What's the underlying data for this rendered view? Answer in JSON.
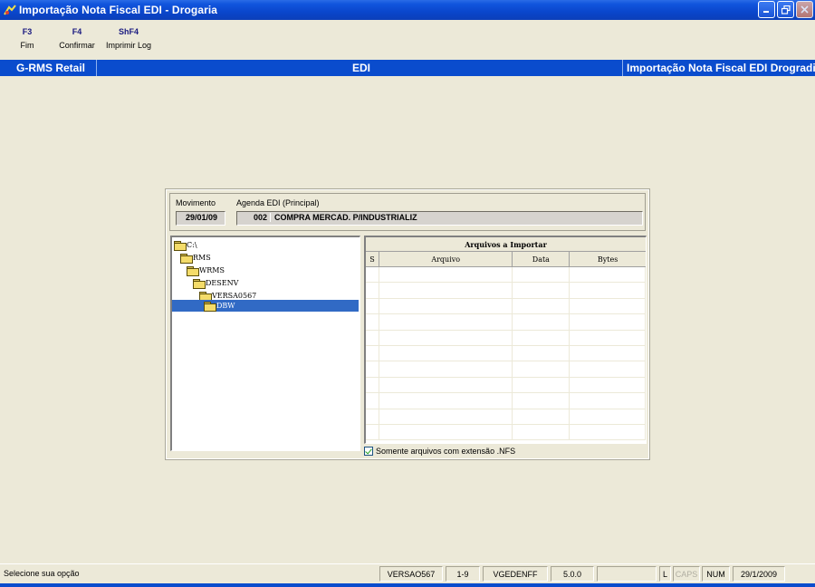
{
  "window": {
    "title": "Importação Nota Fiscal EDI - Drogaria",
    "app_icon": "rms-app-icon",
    "buttons": [
      "minimize-icon",
      "restore-icon",
      "close-icon"
    ]
  },
  "fkeys": [
    {
      "key": "F3",
      "label": "Fim"
    },
    {
      "key": "F4",
      "label": "Confirmar"
    },
    {
      "key": "ShF4",
      "label": "Imprimir Log"
    }
  ],
  "band": {
    "left": "G-RMS Retail",
    "center": "EDI",
    "right": "Importação Nota Fiscal EDI Drogradia"
  },
  "form": {
    "movimento_label": "Movimento",
    "movimento_value": "29/01/09",
    "agenda_label": "Agenda EDI (Principal)",
    "agenda_code": "002",
    "agenda_desc": "COMPRA MERCAD. P/INDUSTRIALIZ"
  },
  "tree": [
    {
      "label": "C:\\",
      "level": 0,
      "selected": false
    },
    {
      "label": "RMS",
      "level": 1,
      "selected": false
    },
    {
      "label": "WRMS",
      "level": 2,
      "selected": false
    },
    {
      "label": "DESENV",
      "level": 3,
      "selected": false
    },
    {
      "label": "VERSA0567",
      "level": 4,
      "selected": false
    },
    {
      "label": "DBW",
      "level": 5,
      "selected": true
    }
  ],
  "grid": {
    "title": "Arquivos a Importar",
    "columns": [
      "S",
      "Arquivo",
      "Data",
      "Bytes"
    ],
    "rows": []
  },
  "checkbox": {
    "label": "Somente arquivos com extensão .NFS",
    "checked": true
  },
  "status": {
    "message": "Selecione sua opção",
    "version": "VERSAO567",
    "page": "1-9",
    "program": "VGEDENFF",
    "release": "5.0.0",
    "blank": "",
    "l": "L",
    "caps": "CAPS",
    "num": "NUM",
    "date": "29/1/2009"
  },
  "colors": {
    "titlebar": "#0a46cc",
    "band": "#0a4ccd",
    "face": "#ece9d8",
    "selection": "#316ac5"
  }
}
